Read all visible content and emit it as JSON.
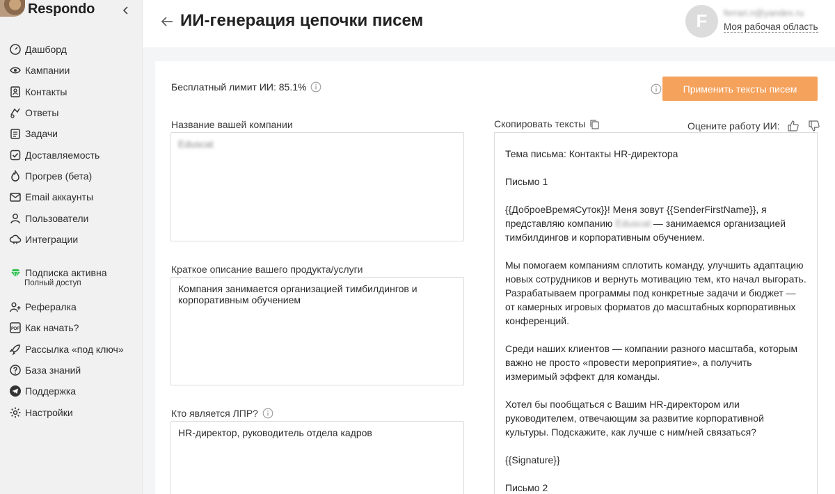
{
  "app": {
    "name": "Respondo",
    "collapse_icon": "chevron-left-icon"
  },
  "sidebar": {
    "items": [
      {
        "label": "Дашборд",
        "icon": "dashboard-icon"
      },
      {
        "label": "Кампании",
        "icon": "campaigns-icon"
      },
      {
        "label": "Контакты",
        "icon": "contacts-icon"
      },
      {
        "label": "Ответы",
        "icon": "replies-icon"
      },
      {
        "label": "Задачи",
        "icon": "tasks-icon"
      },
      {
        "label": "Доставляемость",
        "icon": "checkbox-icon"
      },
      {
        "label": "Прогрев (бета)",
        "icon": "flame-icon"
      },
      {
        "label": "Email аккаунты",
        "icon": "mail-icon"
      },
      {
        "label": "Пользователи",
        "icon": "user-icon"
      },
      {
        "label": "Интеграции",
        "icon": "cloud-icon"
      }
    ],
    "subscription": {
      "title": "Подписка активна",
      "note": "Полный доступ",
      "icon": "diamond-icon",
      "icon_color": "#2fbf4f"
    },
    "items2": [
      {
        "label": "Рефералка",
        "icon": "referral-icon"
      },
      {
        "label": "Как начать?",
        "icon": "pdf-icon"
      },
      {
        "label": "Рассылка «под ключ»",
        "icon": "rocket-icon"
      },
      {
        "label": "База знаний",
        "icon": "help-icon"
      },
      {
        "label": "Поддержка",
        "icon": "telegram-icon"
      },
      {
        "label": "Настройки",
        "icon": "gear-icon"
      }
    ]
  },
  "header": {
    "title": "ИИ-генерация цепочки писем",
    "avatar_letter": "F",
    "user_email": "ferrari.n@yandex.ru",
    "workspace": "Моя рабочая область"
  },
  "form": {
    "limit_text": "Бесплатный лимит ИИ: 85.1%",
    "apply_button": "Применить тексты писем",
    "accent_color": "#f5a25d",
    "company_label": "Название вашей компании",
    "company_value": "Eduscat",
    "product_label": "Краткое описание вашего продукта/услуги",
    "product_value": "Компания занимается организацией тимбилдингов и корпоративным обучением",
    "lpr_label": "Кто является ЛПР?",
    "lpr_value": "HR-директор, руководитель отдела кадров"
  },
  "output": {
    "copy_label": "Скопировать тексты",
    "rate_label": "Оцените работу ИИ:",
    "subject": "Тема письма: Контакты HR-директора",
    "letter1_title": "Письмо 1",
    "p1_start": "{{ДоброеВремяСуток}}! Меня зовут {{SenderFirstName}}, я представляю компанию ",
    "p1_company": "Eduscat",
    "p1_end": " — занимаемся организацией тимбилдингов и корпоративным обучением.",
    "p2": "Мы помогаем компаниям сплотить команду, улучшить адаптацию новых сотрудников и вернуть мотивацию тем, кто начал выгорать. Разрабатываем программы под конкретные задачи и бюджет — от камерных игровых форматов до масштабных корпоративных конференций.",
    "p3": "Среди наших клиентов — компании разного масштаба, которым важно не просто «провести мероприятие», а получить измеримый эффект для команды.",
    "p4": "Хотел бы пообщаться с Вашим HR-директором или руководителем, отвечающим за развитие корпоративной культуры. Подскажите, как лучше с ним/ней связаться?",
    "signature": "{{Signature}}",
    "letter2_title": "Письмо 2"
  }
}
